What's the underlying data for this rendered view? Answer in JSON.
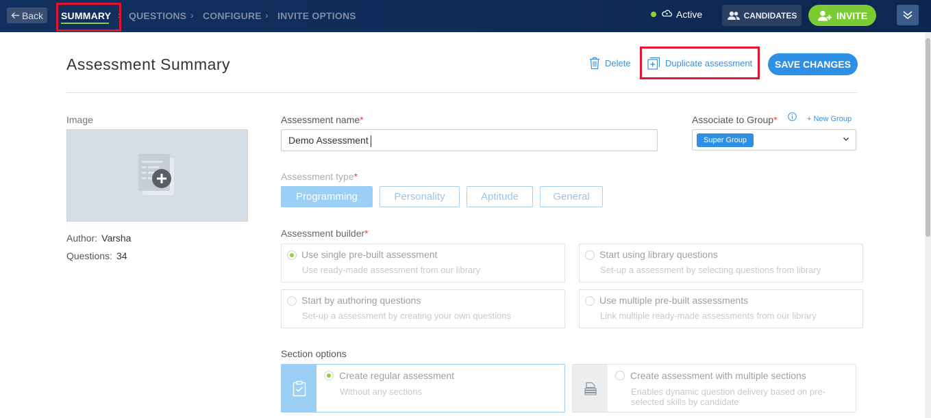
{
  "topbar": {
    "back_label": "Back",
    "steps": [
      "SUMMARY",
      "QUESTIONS",
      "CONFIGURE",
      "INVITE OPTIONS"
    ],
    "status_text": "Active",
    "candidates_label": "CANDIDATES",
    "invite_label": "INVITE",
    "colors": {
      "accent_green": "#8bd33a",
      "bar_bg": "#12305f"
    }
  },
  "header": {
    "title": "Assessment Summary",
    "delete_label": "Delete",
    "duplicate_label": "Duplicate assessment",
    "save_label": "SAVE CHANGES"
  },
  "left": {
    "image_label": "Image",
    "author_label": "Author:",
    "author_value": "Varsha",
    "questions_label": "Questions:",
    "questions_value": "34"
  },
  "form": {
    "name_label": "Assessment name",
    "name_value": "Demo Assessment",
    "required_mark": "*",
    "group_label": "Associate to Group",
    "new_group_label": "+ New Group",
    "group_value": "Super Group",
    "type_label": "Assessment type",
    "types": [
      "Programming",
      "Personality",
      "Aptitude",
      "General"
    ],
    "selected_type": "Programming",
    "builder_label": "Assessment builder",
    "builder_options": [
      {
        "title": "Use single pre-built assessment",
        "sub": "Use ready-made assessment from our library",
        "selected": true
      },
      {
        "title": "Start using library questions",
        "sub": "Set-up a assessment by selecting questions from library",
        "selected": false
      },
      {
        "title": "Start by authoring questions",
        "sub": "Set-up a assessment by creating your own questions",
        "selected": false
      },
      {
        "title": "Use multiple pre-built assessments",
        "sub": "Link multiple ready-made assessments from our library",
        "selected": false
      }
    ],
    "section_label": "Section options",
    "section_options": [
      {
        "title": "Create regular assessment",
        "sub": "Without any sections",
        "selected": true
      },
      {
        "title": "Create assessment with multiple sections",
        "sub_line1": "Enables dynamic question delivery based on pre-",
        "sub_line2": "selected skills by candidate",
        "selected": false
      }
    ]
  },
  "icons": [
    "arrow-left-icon",
    "cloud-status-icon",
    "users-icon",
    "add-user-icon",
    "chevron-down-double-icon",
    "trash-icon",
    "duplicate-icon",
    "image-placeholder-icon",
    "info-icon",
    "chevron-down-icon",
    "clipboard-check-icon",
    "layers-icon"
  ]
}
